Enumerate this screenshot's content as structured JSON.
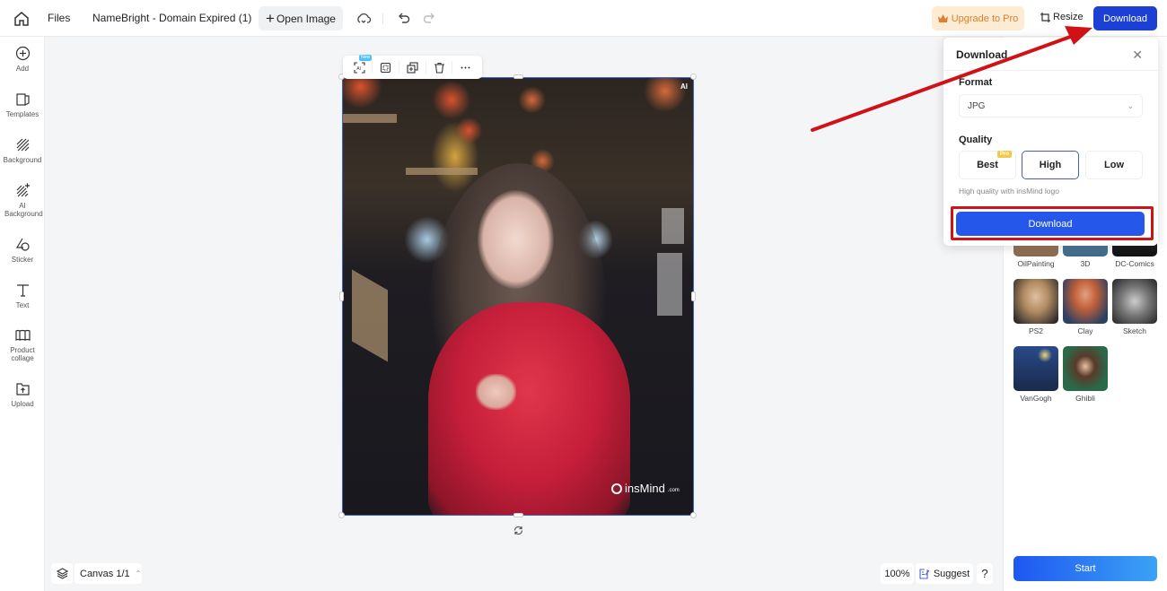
{
  "topbar": {
    "home_icon": "home-icon",
    "files_label": "Files",
    "document_name": "NameBright - Domain Expired (1)",
    "open_image_label": "Open Image",
    "upgrade_label": "Upgrade to Pro",
    "resize_label": "Resize",
    "download_label": "Download"
  },
  "sidebar": {
    "items": [
      {
        "label": "Add",
        "icon": "plus-circle-icon"
      },
      {
        "label": "Templates",
        "icon": "templates-icon"
      },
      {
        "label": "Background",
        "icon": "background-icon"
      },
      {
        "label": "AI Background",
        "icon": "ai-background-icon"
      },
      {
        "label": "Sticker",
        "icon": "sticker-icon"
      },
      {
        "label": "Text",
        "icon": "text-icon"
      },
      {
        "label": "Product collage",
        "icon": "collage-icon"
      },
      {
        "label": "Upload",
        "icon": "upload-icon"
      }
    ]
  },
  "image_toolbar": {
    "new_badge": "New",
    "buttons": [
      "ai-tool",
      "crop",
      "duplicate",
      "delete",
      "more"
    ]
  },
  "image": {
    "ai_badge": "AI",
    "watermark": "insMind",
    "watermark_suffix": ".com"
  },
  "bottom_left": {
    "canvas_label": "Canvas 1/1"
  },
  "bottom_right": {
    "zoom_level": "100%",
    "suggest_label": "Suggest",
    "help_label": "?"
  },
  "download_popup": {
    "title": "Download",
    "format_label": "Format",
    "format_value": "JPG",
    "quality_label": "Quality",
    "quality_options": [
      {
        "label": "Best",
        "badge": "Pro",
        "selected": false
      },
      {
        "label": "High",
        "badge": "",
        "selected": true
      },
      {
        "label": "Low",
        "badge": "",
        "selected": false
      }
    ],
    "hint": "High quality with insMind logo",
    "download_button": "Download"
  },
  "right_panel": {
    "styles": [
      {
        "label": "OilPainting"
      },
      {
        "label": "3D"
      },
      {
        "label": "DC-Comics"
      },
      {
        "label": "PS2"
      },
      {
        "label": "Clay"
      },
      {
        "label": "Sketch"
      },
      {
        "label": "VanGogh"
      },
      {
        "label": "Ghibli"
      }
    ],
    "start_label": "Start"
  },
  "colors": {
    "primary": "#1c3fd4",
    "download_button": "#2657eb",
    "annotation_red": "#d01217",
    "upgrade_bg": "#fdebd3",
    "upgrade_text": "#d9822b"
  }
}
